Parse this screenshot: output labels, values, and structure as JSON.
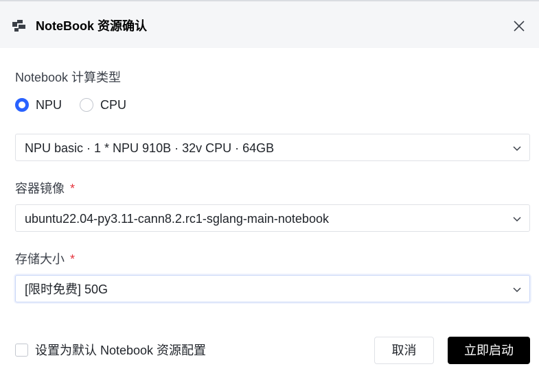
{
  "dialog": {
    "title": "NoteBook 资源确认",
    "close_icon": "close-icon",
    "logo_icon": "notebook-logo-icon"
  },
  "compute": {
    "label": "Notebook 计算类型",
    "options": [
      {
        "label": "NPU",
        "checked": true
      },
      {
        "label": "CPU",
        "checked": false
      }
    ],
    "flavor": "NPU basic · 1 * NPU 910B · 32v CPU · 64GB"
  },
  "image": {
    "label": "容器镜像",
    "required_mark": "*",
    "value": "ubuntu22.04-py3.11-cann8.2.rc1-sglang-main-notebook"
  },
  "storage": {
    "label": "存储大小",
    "required_mark": "*",
    "value": "[限时免费] 50G"
  },
  "footer": {
    "default_checkbox_label": "设置为默认 Notebook 资源配置",
    "cancel_label": "取消",
    "start_label": "立即启动"
  },
  "colors": {
    "accent": "#2962ff",
    "required": "#e5343d",
    "primary_button": "#000000",
    "header_bg": "#f5f6f8"
  }
}
